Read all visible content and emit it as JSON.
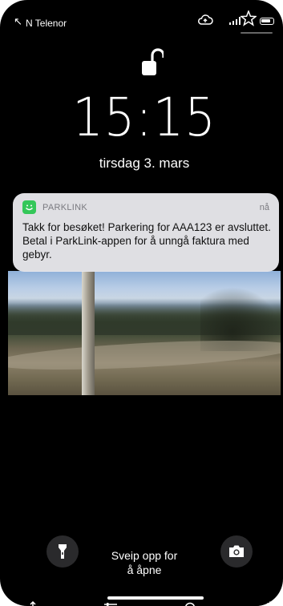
{
  "status_bar": {
    "carrier": "N Telenor"
  },
  "lock_screen": {
    "time": "15:15",
    "date": "tirsdag 3. mars",
    "swipe_hint_line1": "Sveip opp for",
    "swipe_hint_line2": "å åpne"
  },
  "notification": {
    "app_name": "PARKLINK",
    "time": "nå",
    "body": "Takk for besøket! Parkering for AAA123 er avsluttet. Betal i ParkLink-appen for å unngå faktura med gebyr.",
    "icon_color": "#34c759"
  },
  "icons": {
    "lock": "unlocked-padlock-icon",
    "flashlight": "flashlight-icon",
    "camera": "camera-icon",
    "share": "share-icon",
    "adjust": "sliders-icon",
    "trash": "trash-icon"
  }
}
